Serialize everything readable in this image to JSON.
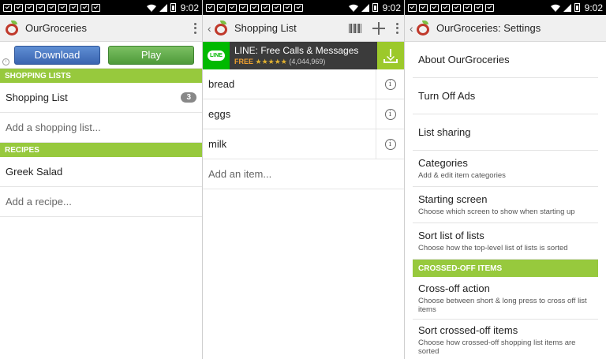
{
  "status": {
    "time": "9:02"
  },
  "panel1": {
    "title": "OurGroceries",
    "ad": {
      "download_label": "Download",
      "play_label": "Play"
    },
    "shopping_lists_header": "SHOPPING LISTS",
    "shopping_list": {
      "name": "Shopping List",
      "count": "3"
    },
    "add_list": "Add a shopping list...",
    "recipes_header": "RECIPES",
    "recipe": "Greek Salad",
    "add_recipe": "Add a recipe..."
  },
  "panel2": {
    "title": "Shopping List",
    "ad": {
      "logo_text": "LINE",
      "title": "LINE: Free Calls & Messages",
      "free": "FREE",
      "stars": "★★★★★",
      "reviews": "(4,044,969)"
    },
    "items": [
      "bread",
      "eggs",
      "milk"
    ],
    "add_item": "Add an item..."
  },
  "panel3": {
    "title": "OurGroceries: Settings",
    "about": "About OurGroceries",
    "turn_off_ads": "Turn Off Ads",
    "list_sharing": "List sharing",
    "categories": {
      "title": "Categories",
      "sub": "Add & edit item categories"
    },
    "starting_screen": {
      "title": "Starting screen",
      "sub": "Choose which screen to show when starting up"
    },
    "sort_lists": {
      "title": "Sort list of lists",
      "sub": "Choose how the top-level list of lists is sorted"
    },
    "crossed_header": "CROSSED-OFF ITEMS",
    "crossoff_action": {
      "title": "Cross-off action",
      "sub": "Choose between short & long press to cross off list items"
    },
    "sort_crossed": {
      "title": "Sort crossed-off items",
      "sub": "Choose how crossed-off shopping list items are sorted"
    }
  }
}
